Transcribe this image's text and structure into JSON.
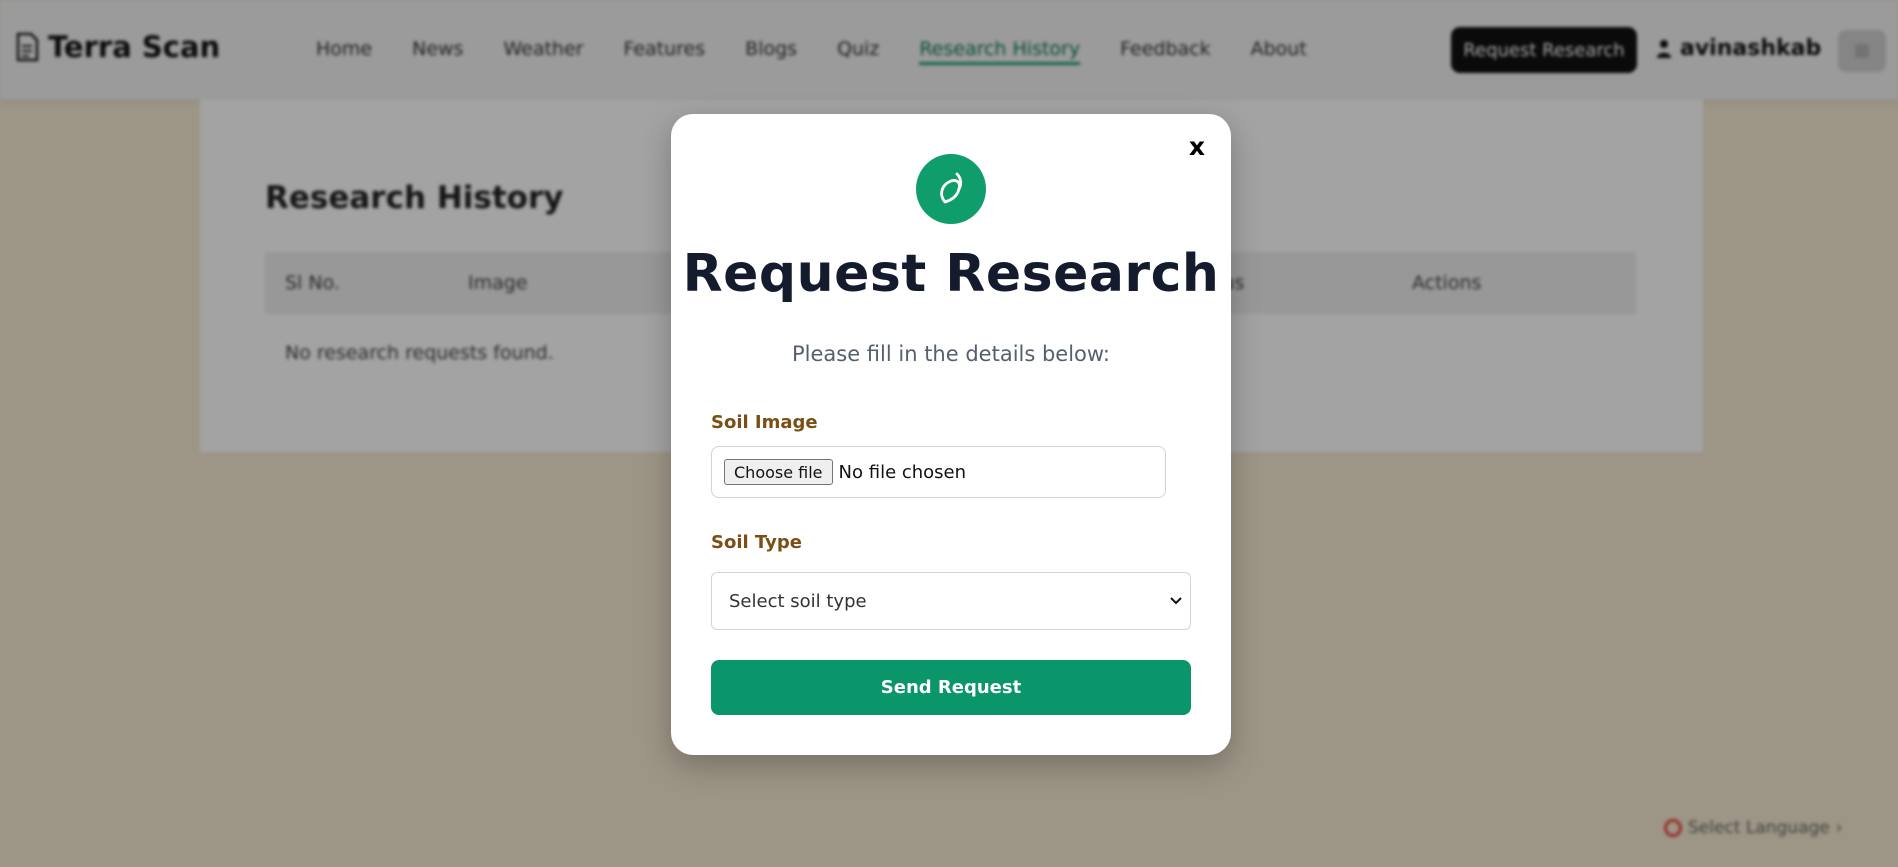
{
  "navbar": {
    "brand": "Terra Scan",
    "links": [
      "Home",
      "News",
      "Weather",
      "Features",
      "Blogs",
      "Quiz",
      "Research History",
      "Feedback",
      "About"
    ],
    "active_link": "Research History",
    "request_button": "Request Research",
    "username": "avinashkab"
  },
  "page": {
    "title": "Research History",
    "table_headers": [
      "Sl No.",
      "Image",
      "",
      "",
      "",
      "tus",
      "Actions"
    ],
    "empty_message": "No research requests found."
  },
  "language_selector": "Select Language",
  "modal": {
    "close_label": "x",
    "title": "Request Research",
    "subtitle": "Please fill in the details below:",
    "soil_image_label": "Soil Image",
    "choose_file_label": "Choose file",
    "file_status": "No file chosen",
    "soil_type_label": "Soil Type",
    "soil_type_selected": "Select soil type",
    "submit_label": "Send Request"
  },
  "colors": {
    "accent_green": "#0a956a",
    "label_brown": "#7a4e14",
    "title_navy": "#141b2d"
  },
  "icons": {
    "brand": "document-icon",
    "modal_badge": "leaf-icon",
    "user": "user-icon",
    "select": "chevron-down-icon"
  }
}
